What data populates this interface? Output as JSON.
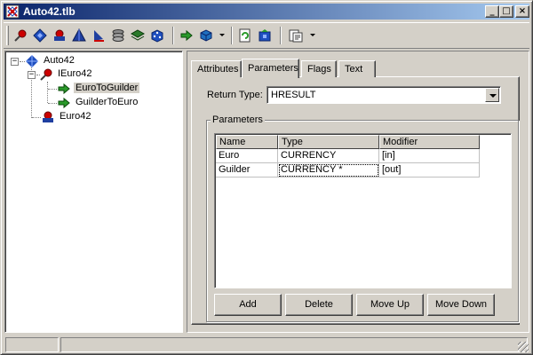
{
  "window": {
    "title": "Auto42.tlb",
    "minimize_glyph": "_",
    "maximize_glyph": "□",
    "close_glyph": "×"
  },
  "toolbar": {
    "buttons": [
      {
        "name": "pin-icon",
        "color": "#cc0000"
      },
      {
        "name": "diamond-icon",
        "color": "#1f4fbf"
      },
      {
        "name": "coclass-icon",
        "color": "#cc0000"
      },
      {
        "name": "pyramid-icon",
        "color": "#1f3fa0"
      },
      {
        "name": "sail-icon",
        "color": "#1f3fa0"
      },
      {
        "name": "stack-icon",
        "color": "#6a6a6a"
      },
      {
        "name": "layers-icon",
        "color": "#2a7a2a"
      },
      {
        "name": "dice-icon",
        "color": "#1f4fbf"
      },
      {
        "name": "method-arrow-icon",
        "color": "#2a9a2a"
      },
      {
        "name": "box-icon",
        "color": "#1f6fbf"
      },
      {
        "name": "refresh-icon",
        "color": "#2a9a2a"
      },
      {
        "name": "properties-icon",
        "color": "#1f4fbf"
      },
      {
        "name": "view-menu-icon",
        "color": "#404040"
      }
    ]
  },
  "tree": {
    "root": {
      "label": "Auto42"
    },
    "interface": {
      "label": "IEuro42"
    },
    "method1": {
      "label": "EuroToGuilder",
      "selected": true
    },
    "method2": {
      "label": "GuilderToEuro"
    },
    "coclass": {
      "label": "Euro42"
    },
    "expand_glyph": "−"
  },
  "tabs": [
    {
      "label": "Attributes",
      "active": false
    },
    {
      "label": "Parameters",
      "active": true
    },
    {
      "label": "Flags",
      "active": false
    },
    {
      "label": "Text",
      "active": false
    }
  ],
  "parameters_tab": {
    "return_type_label": "Return Type:",
    "return_type_value": "HRESULT",
    "group_label": "Parameters",
    "columns": [
      "Name",
      "Type",
      "Modifier"
    ],
    "rows": [
      {
        "name": "Euro",
        "type": "CURRENCY",
        "modifier": "[in]"
      },
      {
        "name": "Guilder",
        "type": "CURRENCY *",
        "modifier": "[out]"
      }
    ],
    "buttons": {
      "add": "Add",
      "delete": "Delete",
      "move_up": "Move Up",
      "move_down": "Move Down"
    }
  },
  "colors": {
    "title_start": "#0a246a",
    "title_end": "#a6caf0",
    "face": "#d4d0c8"
  }
}
